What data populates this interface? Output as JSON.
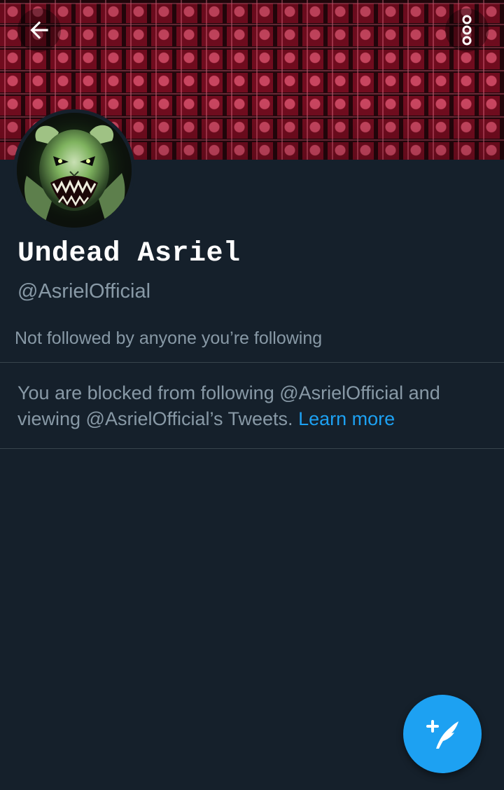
{
  "header": {
    "back_icon": "arrow-left-icon",
    "more_icon": "vertical-dots-icon",
    "banner_colors": {
      "base": "#8c0f26",
      "grid": "#26060c",
      "highlight": "#d64a66"
    }
  },
  "profile": {
    "avatar_icon": "undead-goat-monster-avatar",
    "display_name": "Undead Asriel",
    "handle": "@AsrielOfficial",
    "followed_by_text": "Not followed by anyone you’re following"
  },
  "blocked_notice": {
    "message": "You are blocked from following @AsrielOfficial and viewing @AsrielOfficial’s Tweets.",
    "learn_more_label": "Learn more"
  },
  "compose_fab": {
    "icon": "compose-tweet-feather-icon"
  },
  "colors": {
    "background": "#15202b",
    "secondary_text": "#8899a6",
    "accent": "#1da1f2",
    "divider": "#38444d"
  }
}
